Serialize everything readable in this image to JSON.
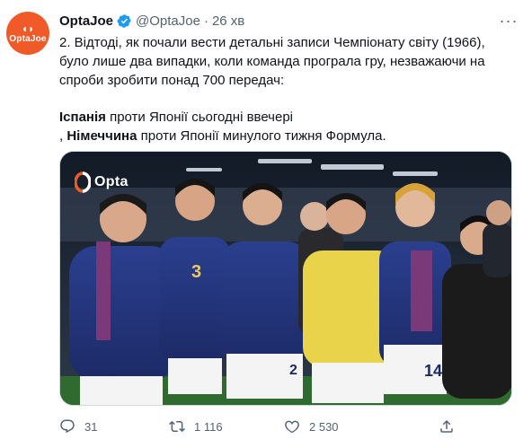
{
  "tweet": {
    "author_name": "OptaJoe",
    "handle": "@OptaJoe",
    "separator": "·",
    "time": "26 хв",
    "avatar_text": "OptaJoe",
    "text_intro": "2. Відтоді, як почали вести детальні записи Чемпіонату світу (1966), було лише два випадки, коли команда програла гру, незважаючи на спроби зробити понад 700 передач:",
    "case1_team": "Іспанія",
    "case1_rest": " проти Японії сьогодні ввечері",
    "case2_prefix": ", ",
    "case2_team": "Німеччина",
    "case2_rest": " проти Японії минулого тижня Формула.",
    "media_watermark": "Opta",
    "media_description_icon": "team-photo",
    "jersey_numbers": [
      "3",
      "14",
      "2"
    ]
  },
  "actions": {
    "replies": "31",
    "retweets": "1 116",
    "likes": "2 530"
  },
  "colors": {
    "brand_blue": "#1d9bf0",
    "opta_orange": "#f05a28",
    "muted": "#536471"
  }
}
